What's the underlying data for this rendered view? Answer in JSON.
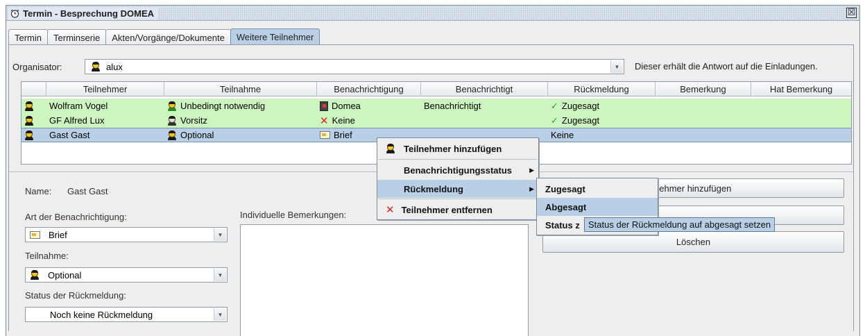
{
  "window": {
    "title": "Termin - Besprechung DOMEA",
    "close_glyph": "☒"
  },
  "tabs": [
    {
      "label": "Termin"
    },
    {
      "label": "Terminserie"
    },
    {
      "label": "Akten/Vorgänge/Dokumente"
    },
    {
      "label": "Weitere Teilnehmer",
      "active": true
    }
  ],
  "organizer": {
    "label": "Organisator:",
    "value": "alux",
    "hint": "Dieser erhält die Antwort auf die Einladungen."
  },
  "table": {
    "columns": [
      "",
      "Teilnehmer",
      "Teilnahme",
      "Benachrichtigung",
      "Benachrichtigt",
      "Rückmeldung",
      "Bemerkung",
      "Hat Bemerkung"
    ],
    "rows": [
      {
        "name": "Wolfram Vogel",
        "participation": "Unbedingt notwendig",
        "notification": "Domea",
        "notification_icon": "domea-icon",
        "notified": "Benachrichtigt",
        "response": "Zugesagt",
        "response_icon": "check-icon",
        "style": "green"
      },
      {
        "name": "GF Alfred Lux",
        "participation": "Vorsitz",
        "notification": "Keine",
        "notification_icon": "x-icon",
        "notified": "",
        "response": "Zugesagt",
        "response_icon": "check-icon",
        "style": "green"
      },
      {
        "name": "Gast Gast",
        "participation": "Optional",
        "notification": "Brief",
        "notification_icon": "letter-icon",
        "notified": "",
        "response": "Keine",
        "response_icon": "",
        "style": "selected"
      }
    ]
  },
  "details": {
    "name_label": "Name:",
    "name_value": "Gast Gast",
    "notify_label": "Art der Benachrichtigung:",
    "notify_value": "Brief",
    "participation_label": "Teilnahme:",
    "participation_value": "Optional",
    "status_label": "Status der Rückmeldung:",
    "status_value": "Noch keine Rückmeldung",
    "remarks_label": "Individuelle Bemerkungen:"
  },
  "buttons": {
    "add_partial": "nehmer hinzufügen",
    "delete": "Löschen"
  },
  "context_menu": {
    "items": [
      {
        "label": "Teilnehmer hinzufügen",
        "icon": "person-icon"
      },
      {
        "label": "Benachrichtigungsstatus",
        "submenu": true
      },
      {
        "label": "Rückmeldung",
        "submenu": true,
        "highlighted": true
      },
      {
        "label": "Teilnehmer entfernen",
        "icon": "x-icon"
      }
    ]
  },
  "submenu": {
    "items": [
      {
        "label": "Zugesagt"
      },
      {
        "label": "Abgesagt",
        "highlighted": true
      },
      {
        "label": "Status z"
      }
    ]
  },
  "tooltip": "Status der Rückmeldung auf abgesagt setzen",
  "colors": {
    "row_green": "#ccf5c0",
    "row_selected": "#b8cfe5",
    "menu_highlight": "#b8cfe5"
  }
}
